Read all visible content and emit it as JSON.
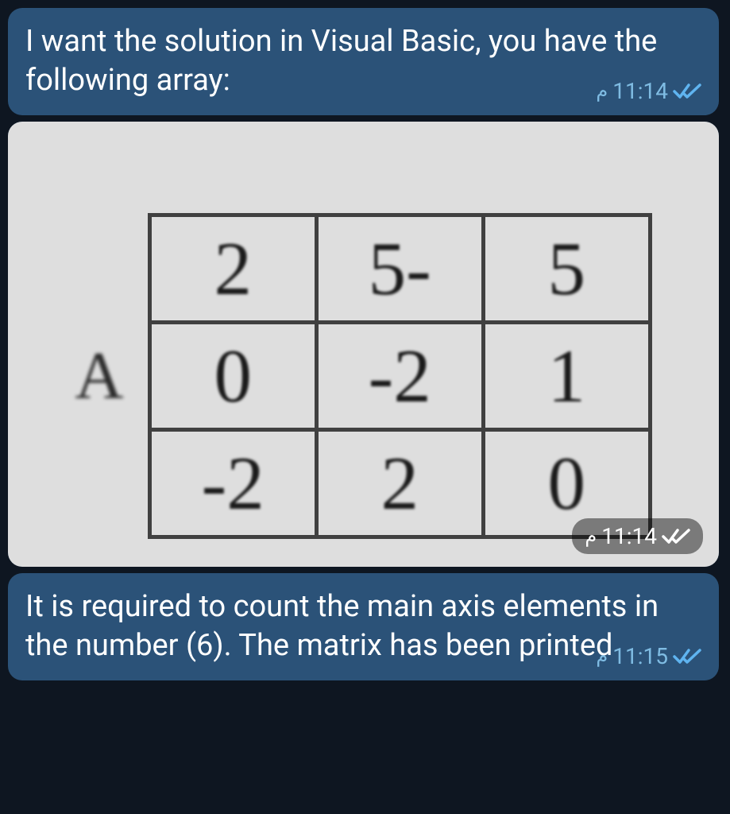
{
  "messages": [
    {
      "text": "I want the solution in Visual Basic, you have the following array:",
      "time": "11:14",
      "meridiem": "م",
      "status": "read"
    },
    {
      "type": "image",
      "time": "11:14",
      "meridiem": "م",
      "status": "read",
      "matrix": {
        "label": "A",
        "rows": [
          [
            "2",
            "5-",
            "5"
          ],
          [
            "0",
            "-2",
            "1"
          ],
          [
            "-2",
            "2",
            "0"
          ]
        ]
      }
    },
    {
      "text": "It is required to count the main axis elements in the number (6). The matrix has been printed",
      "time": "11:15",
      "meridiem": "م",
      "status": "read"
    }
  ],
  "colors": {
    "bubble": "#2b5278",
    "background": "#0e1621",
    "timeColor": "#7fbce3",
    "checkColor": "#5fb4f0"
  }
}
